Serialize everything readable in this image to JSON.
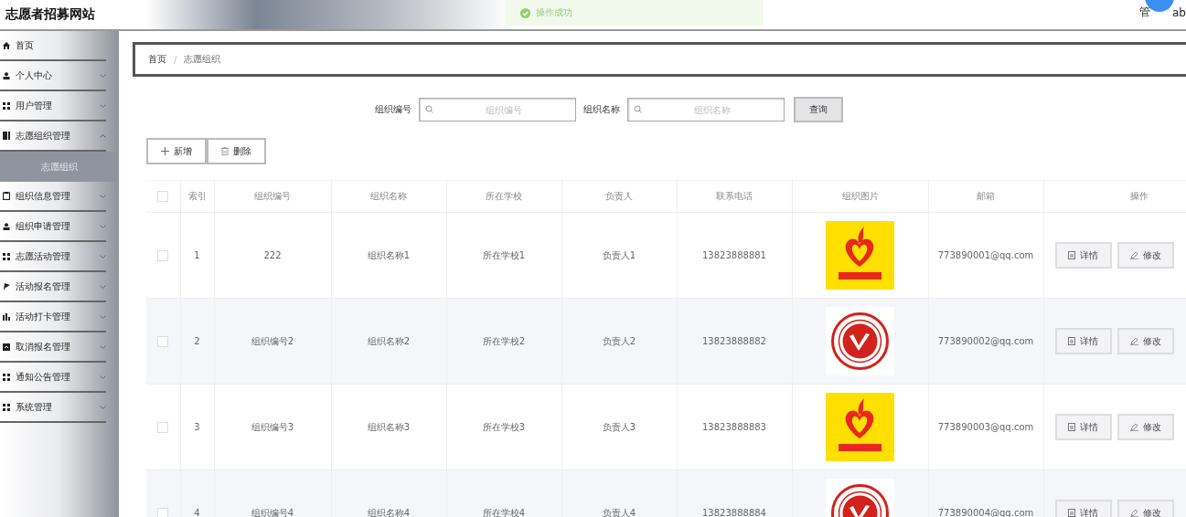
{
  "header": {
    "title": "志愿者招募网站",
    "toast": {
      "kind": "success",
      "message": "操作成功"
    },
    "user": {
      "prefix": "管",
      "suffix": "ab"
    }
  },
  "sidebar": {
    "items": [
      {
        "kind": "link",
        "label": "首页"
      },
      {
        "kind": "menu",
        "label": "个人中心",
        "expanded": false
      },
      {
        "kind": "menu",
        "label": "用户管理",
        "expanded": false
      },
      {
        "kind": "menu",
        "label": "志愿组织管理",
        "expanded": true,
        "children": [
          {
            "label": "志愿组织",
            "selected": true
          }
        ]
      },
      {
        "kind": "menu",
        "label": "组织信息管理",
        "expanded": false
      },
      {
        "kind": "menu",
        "label": "组织申请管理",
        "expanded": false
      },
      {
        "kind": "menu",
        "label": "志愿活动管理",
        "expanded": false
      },
      {
        "kind": "menu",
        "label": "活动报名管理",
        "expanded": false
      },
      {
        "kind": "menu",
        "label": "活动打卡管理",
        "expanded": false
      },
      {
        "kind": "menu",
        "label": "取消报名管理",
        "expanded": false
      },
      {
        "kind": "menu",
        "label": "通知公告管理",
        "expanded": false
      },
      {
        "kind": "menu",
        "label": "系统管理",
        "expanded": false
      }
    ]
  },
  "breadcrumb": {
    "items": [
      "首页",
      "志愿组织"
    ],
    "separator": "/"
  },
  "search": {
    "fields": [
      {
        "label": "组织编号",
        "placeholder": "组织编号"
      },
      {
        "label": "组织名称",
        "placeholder": "组织名称"
      }
    ],
    "button": "查询"
  },
  "toolbar": [
    {
      "kind": "add",
      "label": "新增"
    },
    {
      "kind": "delete",
      "label": "删除"
    }
  ],
  "table": {
    "select_all_checked": false,
    "columns": [
      "索引",
      "组织编号",
      "组织名称",
      "所在学校",
      "负责人",
      "联系电话",
      "组织图片",
      "邮箱",
      "操作"
    ],
    "rows": [
      {
        "checked": false,
        "index": "1",
        "code": "222",
        "name": "组织名称1",
        "school": "所在学校1",
        "leader": "负责人1",
        "phone": "13823888881",
        "email": "773890001@qq.com",
        "actions": [
          {
            "kind": "detail",
            "label": "详情"
          },
          {
            "kind": "edit",
            "label": "修改"
          }
        ]
      },
      {
        "checked": false,
        "index": "2",
        "code": "组织编号2",
        "name": "组织名称2",
        "school": "所在学校2",
        "leader": "负责人2",
        "phone": "13823888882",
        "email": "773890002@qq.com",
        "actions": [
          {
            "kind": "detail",
            "label": "详情"
          },
          {
            "kind": "edit",
            "label": "修改"
          }
        ]
      },
      {
        "checked": false,
        "index": "3",
        "code": "组织编号3",
        "name": "组织名称3",
        "school": "所在学校3",
        "leader": "负责人3",
        "phone": "13823888883",
        "email": "773890003@qq.com",
        "actions": [
          {
            "kind": "detail",
            "label": "详情"
          },
          {
            "kind": "edit",
            "label": "修改"
          }
        ]
      },
      {
        "checked": false,
        "index": "4",
        "code": "组织编号4",
        "name": "组织名称4",
        "school": "所在学校4",
        "leader": "负责人4",
        "phone": "13823888884",
        "email": "773890004@qq.com",
        "actions": [
          {
            "kind": "detail",
            "label": "详情"
          },
          {
            "kind": "edit",
            "label": "修改"
          }
        ]
      }
    ]
  }
}
